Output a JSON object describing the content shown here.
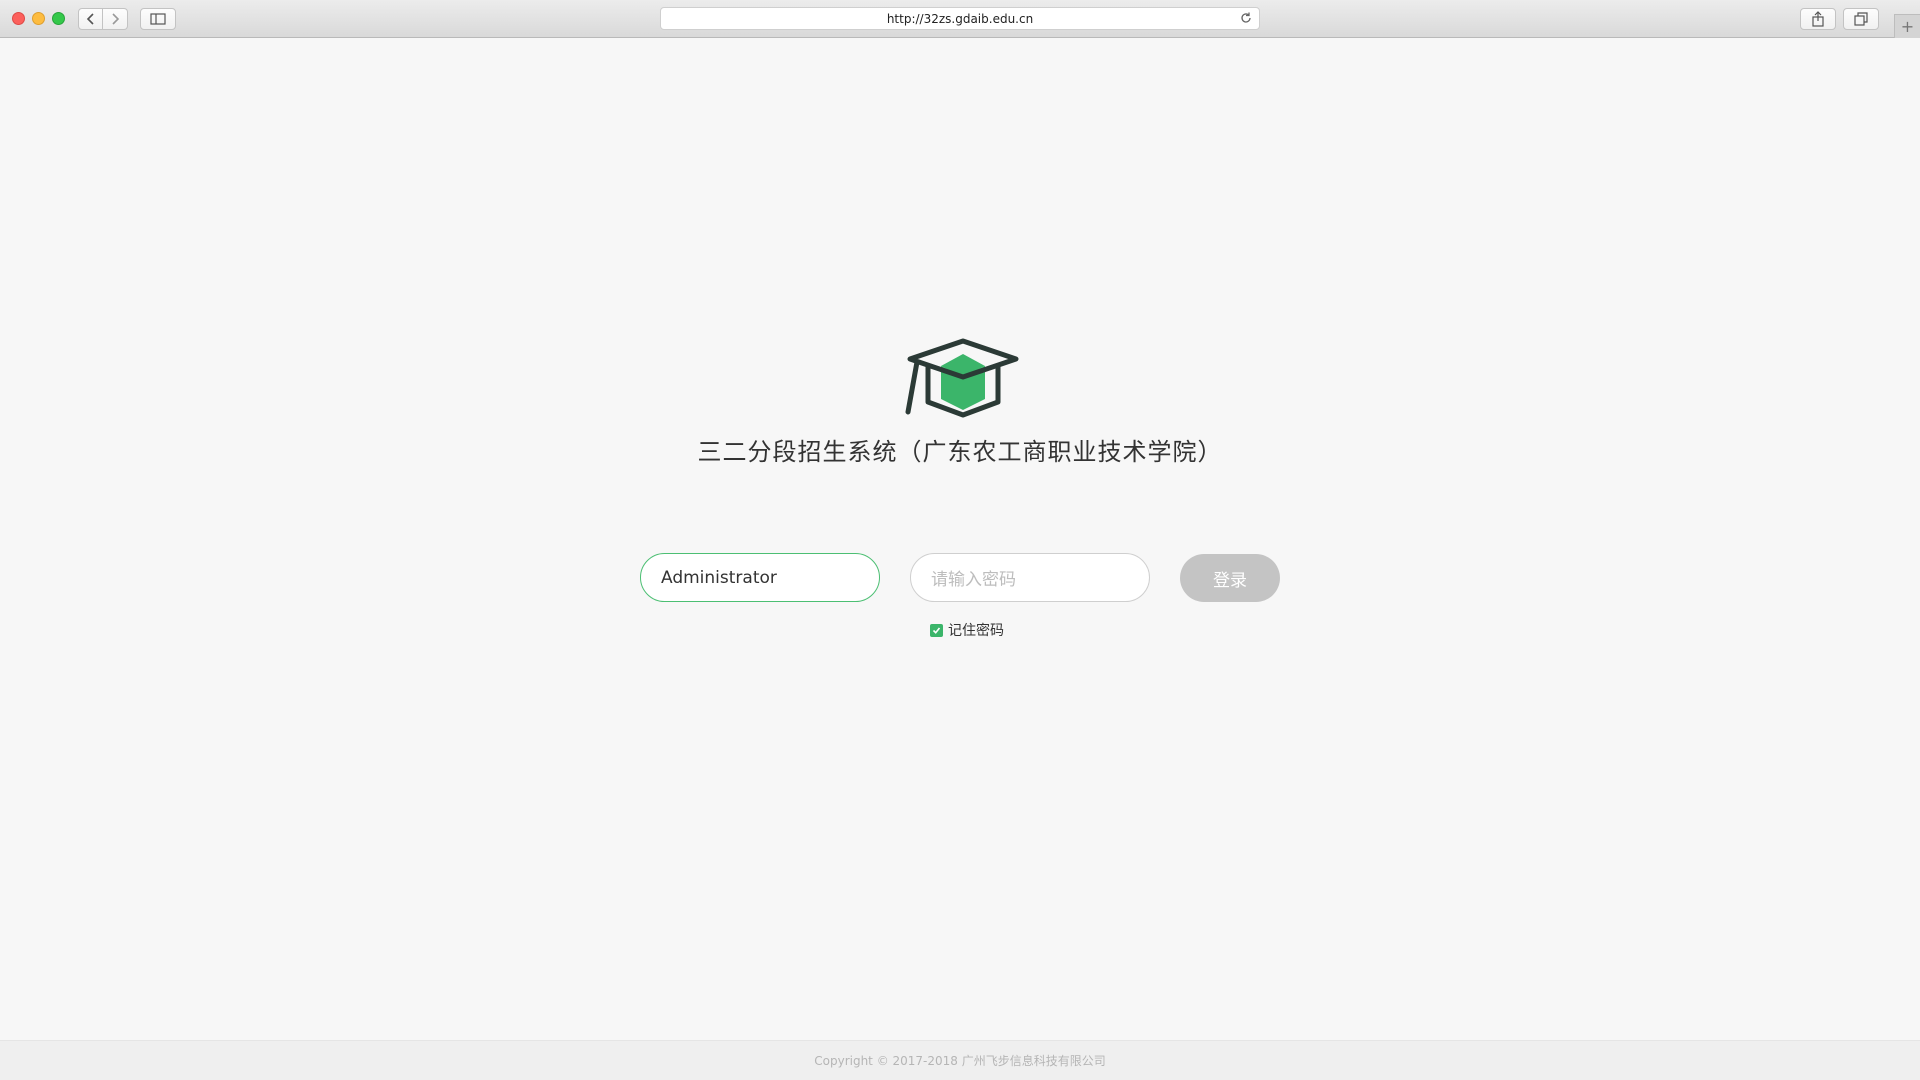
{
  "browser": {
    "url": "http://32zs.gdaib.edu.cn",
    "new_tab_label": "+"
  },
  "app": {
    "title": "三二分段招生系统（广东农工商职业技术学院）",
    "logo_icon": "graduation-cap-icon",
    "accent_color": "#3bb56a"
  },
  "login": {
    "username_value": "Administrator",
    "password_placeholder": "请输入密码",
    "submit_label": "登录",
    "remember_label": "记住密码",
    "remember_checked": true
  },
  "footer": {
    "copyright": "Copyright © 2017-2018 广州飞步信息科技有限公司"
  }
}
